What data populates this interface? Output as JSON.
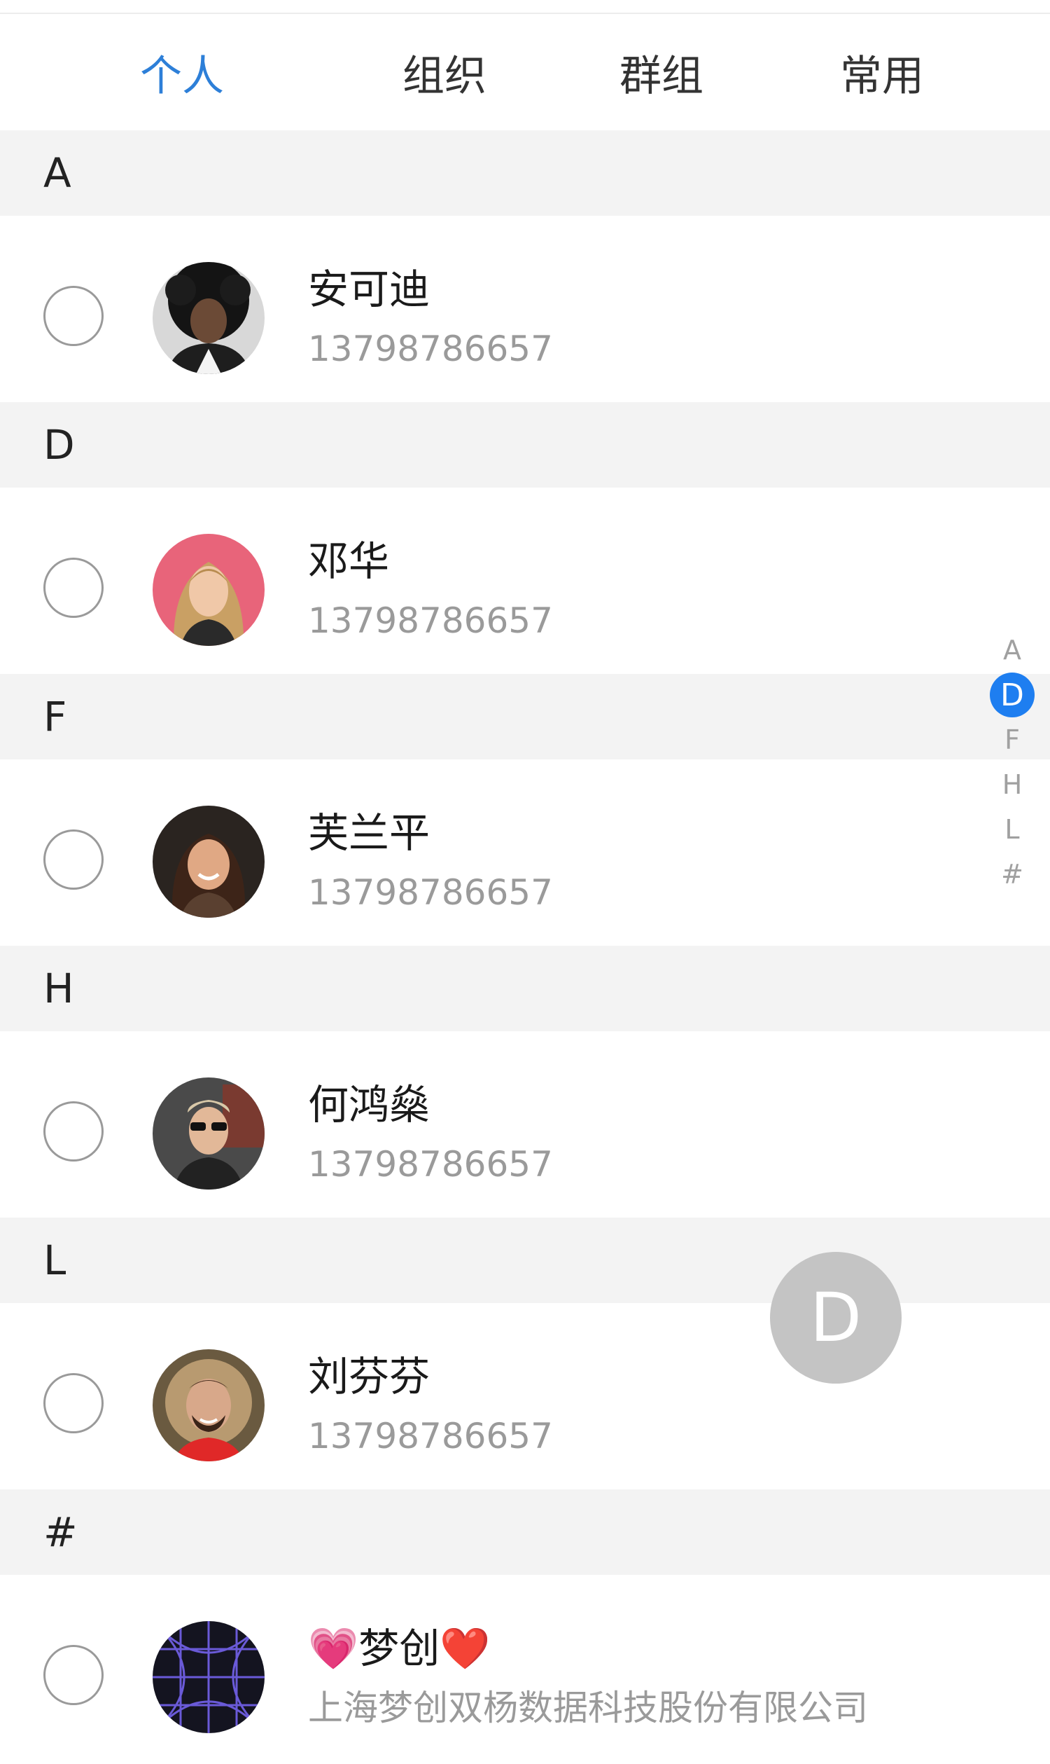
{
  "tabs": [
    {
      "label": "个人",
      "active": true
    },
    {
      "label": "组织",
      "active": false
    },
    {
      "label": "群组",
      "active": false
    },
    {
      "label": "常用",
      "active": false
    }
  ],
  "sections": [
    {
      "letter": "A",
      "contact": {
        "name": "安可迪",
        "phone": "13798786657",
        "avatar": "avatar-curly-hair-person"
      }
    },
    {
      "letter": "D",
      "contact": {
        "name": "邓华",
        "phone": "13798786657",
        "avatar": "avatar-blonde-woman"
      }
    },
    {
      "letter": "F",
      "contact": {
        "name": "芙兰平",
        "phone": "13798786657",
        "avatar": "avatar-smiling-woman"
      }
    },
    {
      "letter": "H",
      "contact": {
        "name": "何鸿燊",
        "phone": "13798786657",
        "avatar": "avatar-man-sunglasses"
      }
    },
    {
      "letter": "L",
      "contact": {
        "name": "刘芬芬",
        "phone": "13798786657",
        "avatar": "avatar-man-fur-hood"
      }
    },
    {
      "letter": "#",
      "contact": {
        "name": "💗梦创❤️",
        "phone": "上海梦创双杨数据科技股份有限公司",
        "avatar": "avatar-grid-logo"
      }
    }
  ],
  "index_bar": {
    "letters": [
      "A",
      "D",
      "F",
      "H",
      "L",
      "#"
    ],
    "active": "D"
  },
  "bubble": {
    "letter": "D"
  },
  "colors": {
    "accent": "#2d7fd8",
    "index_active": "#1e7ef0",
    "section_bg": "#f3f3f3",
    "bubble": "#c4c4c4"
  }
}
